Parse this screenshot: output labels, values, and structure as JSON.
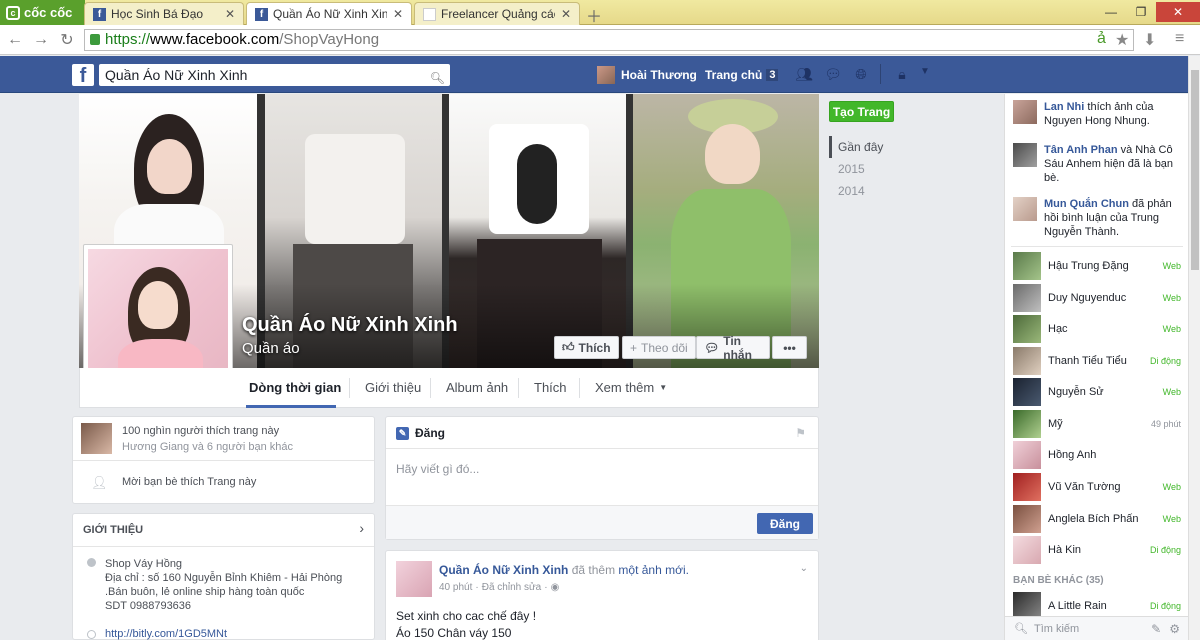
{
  "browser": {
    "brand": "cốc cốc",
    "tabs": [
      {
        "title": "Học Sinh Bá Đạo",
        "favicon": "f"
      },
      {
        "title": "Quần Áo Nữ Xinh Xinh",
        "favicon": "f"
      },
      {
        "title": "Freelancer Quảng cáo face",
        "favicon": "doc"
      }
    ],
    "url_scheme": "https://",
    "url_host": "www.facebook.com",
    "url_path": "/ShopVayHong"
  },
  "fbbar": {
    "search_value": "Quần Áo Nữ Xinh Xinh",
    "user_name": "Hoài Thương",
    "home_label": "Trang chủ",
    "home_count": "3"
  },
  "page": {
    "name": "Quần Áo Nữ Xinh Xinh",
    "category": "Quần áo",
    "buttons": {
      "like": "Thích",
      "follow": "Theo dõi",
      "message": "Tin nhắn",
      "more": "•••"
    },
    "tabs": [
      "Dòng thời gian",
      "Giới thiệu",
      "Album ảnh",
      "Thích",
      "Xem thêm"
    ]
  },
  "sidebar_right": {
    "create_page": "Tạo Trang",
    "years": [
      "Gần đây",
      "2015",
      "2014"
    ]
  },
  "likes": {
    "count_text": "100 nghìn người thích trang này",
    "friends_text": "Hương Giang và 6 người bạn khác",
    "invite_text": "Mời bạn bè thích Trang này"
  },
  "intro": {
    "heading": "GIỚI THIỆU",
    "shop_name": "Shop Váy Hồng",
    "address": "Địa chỉ : số 160 Nguyễn Bỉnh Khiêm - Hải Phòng .Bán buôn, lẻ online ship hàng toàn quốc",
    "phone": "SDT 0988793636",
    "link": "http://bitly.com/1GD5MNt"
  },
  "composer": {
    "tab_label": "Đăng",
    "placeholder": "Hãy viết gì đó...",
    "post_button": "Đăng"
  },
  "post": {
    "author": "Quần Áo Nữ Xinh Xinh",
    "action": "đã thêm",
    "action_link": "một ảnh mới.",
    "time": "40 phút",
    "edited": "Đã chỉnh sửa",
    "line1": "Set xinh cho cac chế đây !",
    "line2": "Áo 150 Chân váy 150"
  },
  "chat": {
    "notifications": [
      {
        "name": "Lan Nhi",
        "text": "thích ảnh của Nguyen Hong Nhung."
      },
      {
        "name": "Tân Anh Phan",
        "text": "và Nhà Cô Sáu Anhem hiện đã là bạn bè."
      },
      {
        "name": "Mun Quắn Chun",
        "text": "đã phản hồi bình luận của Trung Nguyễn Thành."
      }
    ],
    "contacts": [
      {
        "name": "Hậu Trung Đặng",
        "status": "Web"
      },
      {
        "name": "Duy Nguyenduc",
        "status": "Web"
      },
      {
        "name": "Hạc",
        "status": "Web"
      },
      {
        "name": "Thanh Tiểu Tiểu",
        "status": "Di động"
      },
      {
        "name": "Nguyễn Sử",
        "status": "Web"
      },
      {
        "name": "Mỹ",
        "status": "49 phút"
      },
      {
        "name": "Hồng Anh",
        "status": ""
      },
      {
        "name": "Vũ Văn Tường",
        "status": "Web"
      },
      {
        "name": "Anglela Bích Phấn",
        "status": "Web"
      },
      {
        "name": "Hà Kin",
        "status": "Di động"
      }
    ],
    "other_friends": "BẠN BÈ KHÁC (35)",
    "other_contact": {
      "name": "A Little Rain",
      "status": "Di động"
    },
    "search_placeholder": "Tìm kiếm"
  }
}
